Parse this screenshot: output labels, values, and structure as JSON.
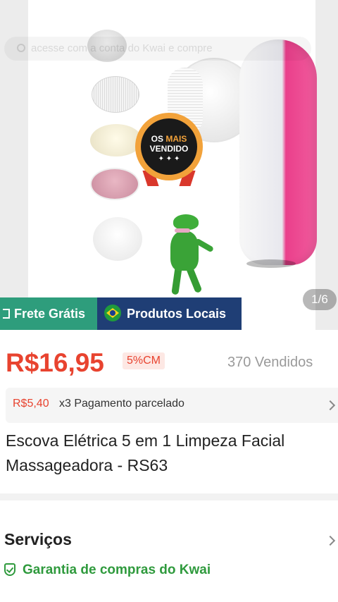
{
  "hero": {
    "search_placeholder": "acesse com a conta do Kwai e compre",
    "badge_line1_a": "OS",
    "badge_line1_b": "MAIS",
    "badge_line2": "VENDIDO",
    "badge_star": "✦ ✦ ✦",
    "counter": "1/6",
    "tags": {
      "frete": "Frete Grátis",
      "locais": "Produtos Locais"
    }
  },
  "price": {
    "value": "R$16,95",
    "cm_badge": "5%CM",
    "sold": "370 Vendidos"
  },
  "installment": {
    "amount": "R$5,40",
    "text": "x3 Pagamento parcelado"
  },
  "product": {
    "title": "Escova Elétrica 5 em 1 Limpeza Facial Massageadora - RS63"
  },
  "services": {
    "title": "Serviços",
    "guarantee": "Garantia de compras do Kwai"
  },
  "colors": {
    "price": "#e8432f",
    "frete_tag": "#2e9d7c",
    "local_tag": "#1f3e75",
    "guarantee": "#2f9a3d",
    "device_accent": "#ea3f8b"
  },
  "icons": [
    "search-icon",
    "brazil-flag-icon",
    "truck-box-icon",
    "chevron-right-icon",
    "shield-check-icon"
  ]
}
